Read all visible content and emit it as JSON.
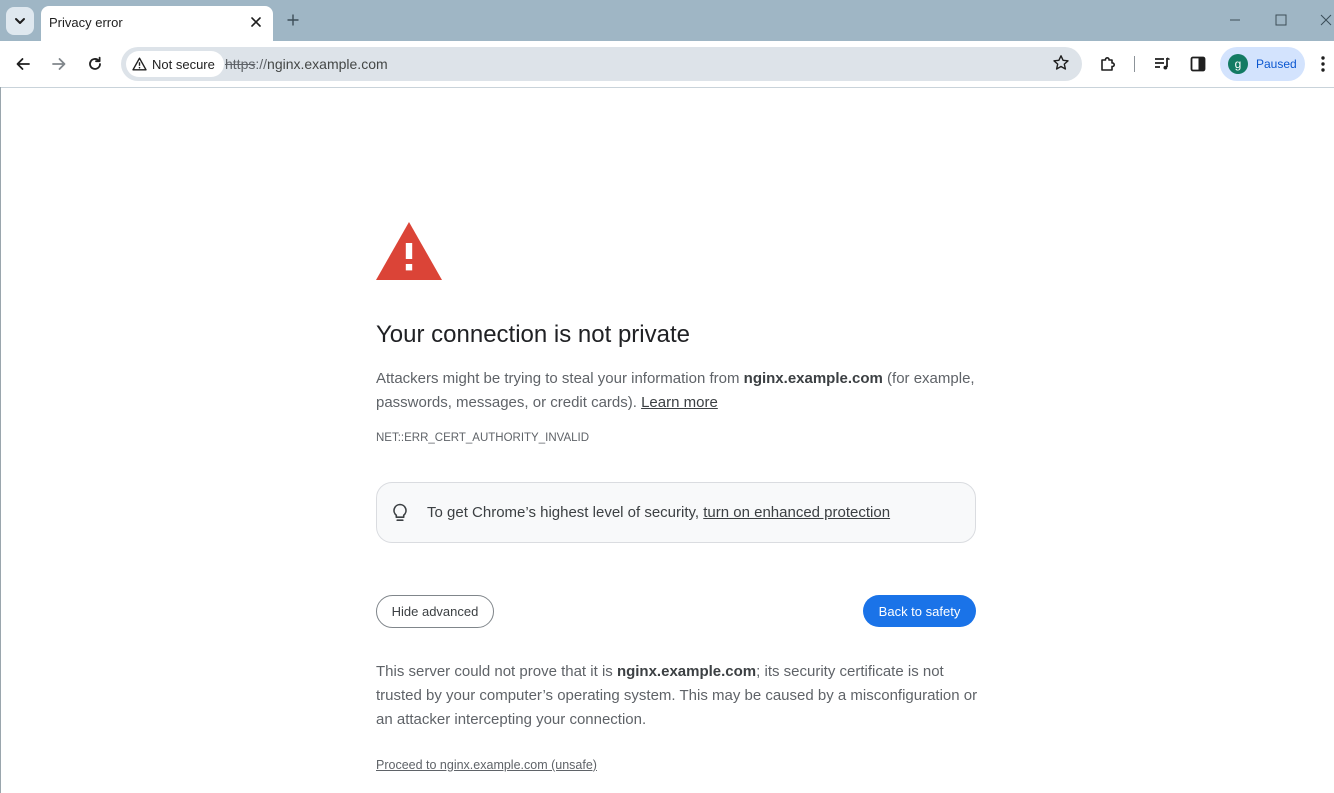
{
  "browser": {
    "tab": {
      "title": "Privacy error"
    },
    "address_bar": {
      "security_chip_label": "Not secure",
      "url_scheme": "https",
      "url_separator": "://",
      "url_host": "nginx.example.com"
    },
    "profile": {
      "initial": "g",
      "status": "Paused"
    }
  },
  "page": {
    "heading": "Your connection is not private",
    "intro": {
      "before": "Attackers might be trying to steal your information from ",
      "host": "nginx.example.com",
      "after": " (for example, passwords, messages, or credit cards). ",
      "learn_more": "Learn more"
    },
    "error_code": "NET::ERR_CERT_AUTHORITY_INVALID",
    "enhanced_protection": {
      "text": "To get Chrome’s highest level of security, ",
      "link": "turn on enhanced protection"
    },
    "buttons": {
      "hide_advanced": "Hide advanced",
      "back_to_safety": "Back to safety"
    },
    "details": {
      "before": "This server could not prove that it is ",
      "host": "nginx.example.com",
      "after": "; its security certificate is not trusted by your computer’s operating system. This may be caused by a misconfiguration or an attacker intercepting your connection."
    },
    "proceed_link": "Proceed to nginx.example.com (unsafe)"
  },
  "colors": {
    "frame": "#9fb6c5",
    "warning_red": "#db4437",
    "primary_blue": "#1a73e8",
    "profile_avatar": "#137b63"
  }
}
